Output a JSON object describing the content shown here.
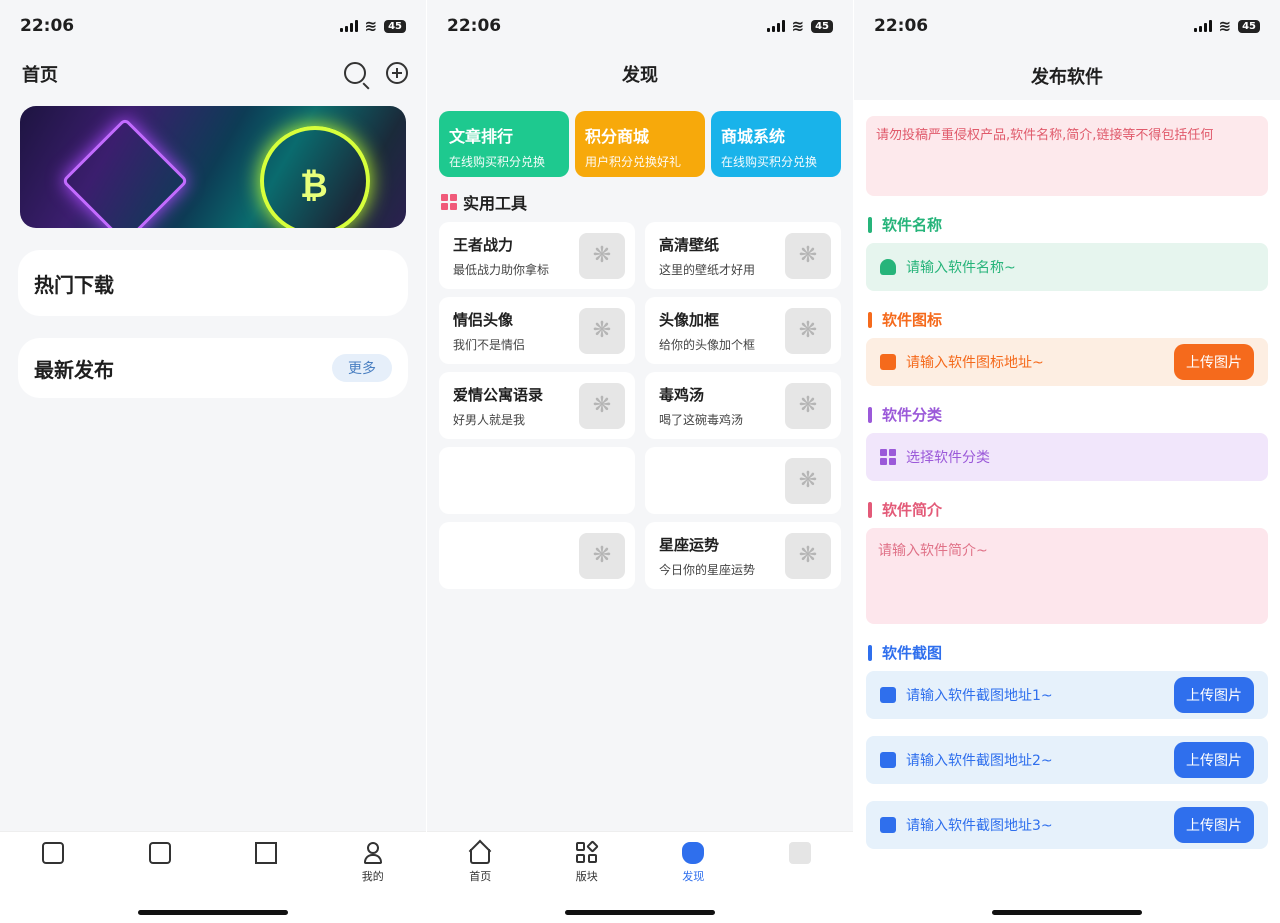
{
  "status": {
    "time": "22:06",
    "battery": "45"
  },
  "home": {
    "title": "首页",
    "hot_downloads": "热门下载",
    "latest": "最新发布",
    "more": "更多",
    "tabs": [
      "",
      "",
      "",
      "我的"
    ]
  },
  "discover": {
    "title": "发现",
    "features": [
      {
        "title": "文章排行",
        "sub": "在线购买积分兑换",
        "color": "#1ec98f"
      },
      {
        "title": "积分商城",
        "sub": "用户积分兑换好礼",
        "color": "#f7a90b"
      },
      {
        "title": "商城系统",
        "sub": "在线购买积分兑换",
        "color": "#19b3ea"
      }
    ],
    "section": "实用工具",
    "tools": [
      {
        "title": "王者战力",
        "sub": "最低战力助你拿标"
      },
      {
        "title": "高清壁纸",
        "sub": "这里的壁纸才好用"
      },
      {
        "title": "情侣头像",
        "sub": "我们不是情侣"
      },
      {
        "title": "头像加框",
        "sub": "给你的头像加个框"
      },
      {
        "title": "爱情公寓语录",
        "sub": "好男人就是我"
      },
      {
        "title": "毒鸡汤",
        "sub": "喝了这碗毒鸡汤"
      },
      {
        "title": "",
        "sub": ""
      },
      {
        "title": "",
        "sub": ""
      },
      {
        "title": "",
        "sub": ""
      },
      {
        "title": "星座运势",
        "sub": "今日你的星座运势"
      }
    ],
    "tabs": [
      "首页",
      "版块",
      "发现",
      ""
    ]
  },
  "publish": {
    "title": "发布软件",
    "notice": "请勿投稿严重侵权产品,软件名称,简介,链接等不得包括任何",
    "name_label": "软件名称",
    "name_placeholder": "请输入软件名称~",
    "icon_label": "软件图标",
    "icon_placeholder": "请输入软件图标地址~",
    "upload": "上传图片",
    "category_label": "软件分类",
    "category_placeholder": "选择软件分类",
    "intro_label": "软件简介",
    "intro_placeholder": "请输入软件简介~",
    "shots_label": "软件截图",
    "shot1": "请输入软件截图地址1~",
    "shot2": "请输入软件截图地址2~",
    "shot3": "请输入软件截图地址3~"
  },
  "colors": {
    "blue": "#2f6fed",
    "orange": "#f56a1c",
    "green": "#26b47a",
    "purple": "#9b59d9",
    "pink": "#e35a78"
  }
}
